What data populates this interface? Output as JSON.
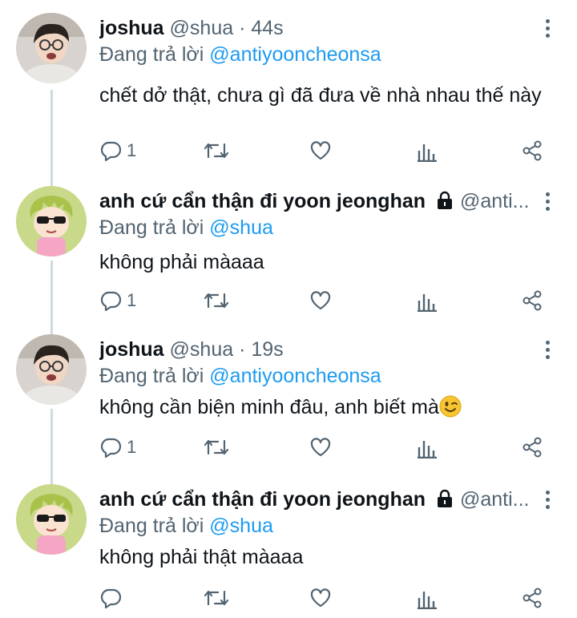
{
  "tweets": [
    {
      "name": "joshua",
      "handle": "@shua",
      "separator": "·",
      "time": "44s",
      "locked": false,
      "reply_prefix": "Đang trả lời",
      "reply_to": "@antiyooncheonsa",
      "text": "chết dở thật, chưa gì đã đưa về nhà nhau thế này",
      "reply_count": "1",
      "avatar": "photo-avatar"
    },
    {
      "name": "anh cứ cẩn thận đi yoon jeonghan",
      "handle": "@anti...",
      "separator": "",
      "time": "",
      "locked": true,
      "reply_prefix": "Đang trả lời",
      "reply_to": "@shua",
      "text": "không phải màaaa",
      "reply_count": "1",
      "avatar": "cartoon-avatar"
    },
    {
      "name": "joshua",
      "handle": "@shua",
      "separator": "·",
      "time": "19s",
      "locked": false,
      "reply_prefix": "Đang trả lời",
      "reply_to": "@antiyooncheonsa",
      "text": "không cần biện minh đâu, anh biết mà",
      "emoji": "winking-face",
      "reply_count": "1",
      "avatar": "photo-avatar"
    },
    {
      "name": "anh cứ cẩn thận đi yoon jeonghan",
      "handle": "@anti...",
      "separator": "",
      "time": "",
      "locked": true,
      "reply_prefix": "Đang trả lời",
      "reply_to": "@shua",
      "text": "không phải thật màaaa",
      "reply_count": "",
      "avatar": "cartoon-avatar"
    }
  ],
  "icons": [
    "reply-icon",
    "retweet-icon",
    "like-icon",
    "analytics-icon",
    "share-icon",
    "more-icon",
    "lock-icon"
  ],
  "colors": {
    "text": "#0f1419",
    "secondary": "#536471",
    "mention": "#1d9bf0",
    "thread_line": "#cfd9de"
  }
}
